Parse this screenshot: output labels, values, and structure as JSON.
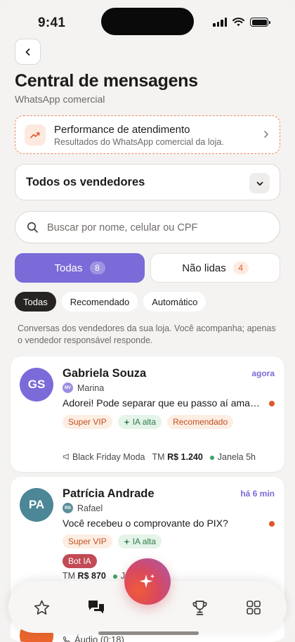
{
  "status_bar": {
    "time": "9:41"
  },
  "header": {
    "title": "Central de mensagens",
    "subtitle": "WhatsApp comercial"
  },
  "performance_card": {
    "title": "Performance de atendimento",
    "subtitle": "Resultados do WhatsApp comercial da loja."
  },
  "seller_filter": {
    "selected": "Todos os vendedores"
  },
  "search": {
    "placeholder": "Buscar por nome, celular ou CPF"
  },
  "segments": [
    {
      "label": "Todas",
      "count": "8",
      "active": true
    },
    {
      "label": "Não lidas",
      "count": "4",
      "active": false
    }
  ],
  "chips": [
    {
      "label": "Todas",
      "active": true
    },
    {
      "label": "Recomendado",
      "active": false
    },
    {
      "label": "Automático",
      "active": false
    }
  ],
  "info_text": "Conversas dos vendedores da sua loja. Você acompanha; apenas o vendedor responsável responde.",
  "conversations": [
    {
      "initials": "GS",
      "avatar_color": "#7b6bd8",
      "name": "Gabriela Souza",
      "time": "agora",
      "seller_initials": "MV",
      "seller_color": "#9b8de0",
      "seller": "Marina",
      "message": "Adorei! Pode separar que eu passo aí amanhã pra buscar?",
      "unread": true,
      "tags": [
        "Super VIP",
        "IA alta",
        "Recomendado"
      ],
      "campaign": "Black Friday Moda",
      "tm_label": "TM",
      "tm_value": "R$ 1.240",
      "window": "Janela 5h"
    },
    {
      "initials": "PA",
      "avatar_color": "#4b8796",
      "name": "Patrícia Andrade",
      "time": "há 6 min",
      "seller_initials": "RN",
      "seller_color": "#5c8f99",
      "seller": "Rafael",
      "message": "Você recebeu o comprovante do PIX?",
      "unread": true,
      "tags": [
        "Super VIP",
        "IA alta",
        "Bot IA"
      ],
      "tm_label": "TM",
      "tm_value": "R$ 870",
      "window": "Ja"
    },
    {
      "preview": "Áudio (0:18)"
    }
  ],
  "colors": {
    "accent": "#7b6bd8",
    "orange": "#e0582a",
    "green": "#3fa363"
  },
  "nav": {
    "items": [
      "star-icon",
      "chat-icon",
      "sparkle-icon",
      "trophy-icon",
      "grid-icon"
    ]
  }
}
